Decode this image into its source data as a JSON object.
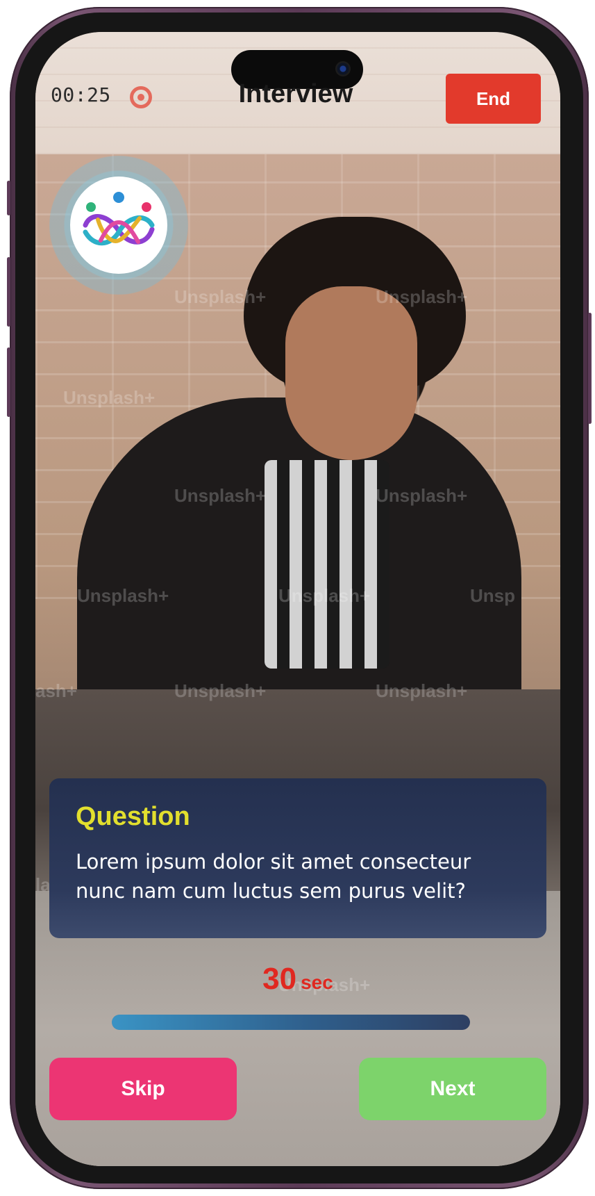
{
  "header": {
    "timer": "00:25",
    "title": "Interview",
    "end_label": "End",
    "record_icon": "record-indicator-icon"
  },
  "video": {
    "watermark_text": "Unsplash+",
    "watermark_partial_1": "ash+",
    "watermark_partial_2": "Unsp",
    "watermark_partial_3": "lash+",
    "logo_icon": "interlinked-people-logo"
  },
  "question": {
    "label": "Question",
    "text": "Lorem ipsum dolor sit amet consecteur nunc nam cum luctus sem purus velit?"
  },
  "countdown": {
    "value": "30",
    "unit": "sec",
    "remaining_fraction": 1.0
  },
  "actions": {
    "skip_label": "Skip",
    "next_label": "Next"
  },
  "colors": {
    "end_button": "#e23a2c",
    "question_label": "#e2df2e",
    "question_card": "#24304f",
    "countdown": "#e02820",
    "skip_button": "#ec3573",
    "next_button": "#7dd36b"
  }
}
